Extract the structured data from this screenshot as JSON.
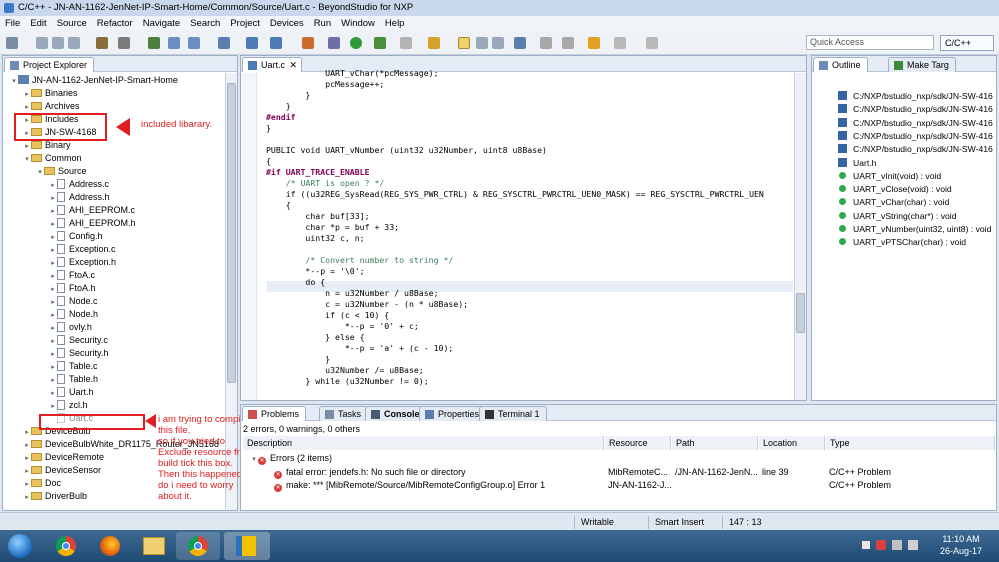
{
  "window": {
    "title": "C/C++ - JN-AN-1162-JenNet-IP-Smart-Home/Common/Source/Uart.c - BeyondStudio for NXP"
  },
  "menu": [
    "File",
    "Edit",
    "Source",
    "Refactor",
    "Navigate",
    "Search",
    "Project",
    "Devices",
    "Run",
    "Window",
    "Help"
  ],
  "toolbar": {
    "quick_access_placeholder": "Quick Access",
    "perspective": "C/C++"
  },
  "project_explorer": {
    "tab": "Project Explorer",
    "items": [
      {
        "label": "JN-AN-1162-JenNet-IP-Smart-Home",
        "kind": "project",
        "twisty": "▾"
      },
      {
        "label": "Binaries",
        "kind": "folder",
        "twisty": "▸"
      },
      {
        "label": "Archives",
        "kind": "folder",
        "twisty": "▸"
      },
      {
        "label": "Includes",
        "kind": "folder",
        "twisty": "▸"
      },
      {
        "label": "JN-SW-4168",
        "kind": "folder",
        "twisty": "▸"
      },
      {
        "label": "Binary",
        "kind": "folder",
        "twisty": "▸"
      },
      {
        "label": "Common",
        "kind": "folder",
        "twisty": "▾"
      },
      {
        "label": "Source",
        "kind": "folder",
        "twisty": "▾"
      },
      {
        "label": "Address.c",
        "kind": "c",
        "twisty": "▸"
      },
      {
        "label": "Address.h",
        "kind": "h",
        "twisty": "▸"
      },
      {
        "label": "AHI_EEPROM.c",
        "kind": "c",
        "twisty": "▸"
      },
      {
        "label": "AHI_EEPROM.h",
        "kind": "h",
        "twisty": "▸"
      },
      {
        "label": "Config.h",
        "kind": "h",
        "twisty": "▸"
      },
      {
        "label": "Exception.c",
        "kind": "c",
        "twisty": "▸"
      },
      {
        "label": "Exception.h",
        "kind": "h",
        "twisty": "▸"
      },
      {
        "label": "FtoA.c",
        "kind": "c",
        "twisty": "▸"
      },
      {
        "label": "FtoA.h",
        "kind": "h",
        "twisty": "▸"
      },
      {
        "label": "Node.c",
        "kind": "c",
        "twisty": "▸"
      },
      {
        "label": "Node.h",
        "kind": "h",
        "twisty": "▸"
      },
      {
        "label": "ovly.h",
        "kind": "h",
        "twisty": "▸"
      },
      {
        "label": "Security.c",
        "kind": "c",
        "twisty": "▸"
      },
      {
        "label": "Security.h",
        "kind": "h",
        "twisty": "▸"
      },
      {
        "label": "Table.c",
        "kind": "c",
        "twisty": "▸"
      },
      {
        "label": "Table.h",
        "kind": "h",
        "twisty": "▸"
      },
      {
        "label": "Uart.h",
        "kind": "h",
        "twisty": "▸"
      },
      {
        "label": "zcl.h",
        "kind": "h",
        "twisty": "▸"
      },
      {
        "label": "Uart.c",
        "kind": "c-excluded",
        "twisty": ""
      },
      {
        "label": "DeviceBulb",
        "kind": "folder",
        "twisty": "▸"
      },
      {
        "label": "DeviceBulbWhite_DR1175_Router_JN5168",
        "kind": "folder",
        "twisty": "▸"
      },
      {
        "label": "DeviceRemote",
        "kind": "folder",
        "twisty": "▸"
      },
      {
        "label": "DeviceSensor",
        "kind": "folder",
        "twisty": "▸"
      },
      {
        "label": "Doc",
        "kind": "folder",
        "twisty": "▸"
      },
      {
        "label": "DriverBulb",
        "kind": "folder",
        "twisty": "▸"
      }
    ]
  },
  "annotations": {
    "included_library": "included libarary.",
    "note_lines": [
      "i am trying to compile",
      "this file.",
      "so if you tried to",
      "Exclude resource from",
      "build tick this box.",
      "Then this happened.",
      "do i need to worry",
      "about it."
    ]
  },
  "editor": {
    "tab": "Uart.c",
    "lines": [
      "            UART_vChar(*pcMessage);",
      "            pcMessage++;",
      "        }",
      "    }",
      "#endif",
      "}",
      "",
      "PUBLIC void UART_vNumber (uint32 u32Number, uint8 u8Base)",
      "{",
      "#if UART_TRACE_ENABLE",
      "    /* UART is open ? */",
      "    if ((u32REG_SysRead(REG_SYS_PWR_CTRL) & REG_SYSCTRL_PWRCTRL_UEN0_MASK) == REG_SYSCTRL_PWRCTRL_UEN",
      "    {",
      "        char buf[33];",
      "        char *p = buf + 33;",
      "        uint32 c, n;",
      "",
      "        /* Convert number to string */",
      "        *--p = '\\0';",
      "        do {",
      "            n = u32Number / u8Base;",
      "            c = u32Number - (n * u8Base);",
      "            if (c < 10) {",
      "                *--p = '0' + c;",
      "            } else {",
      "                *--p = 'a' + (c - 10);",
      "            }",
      "            u32Number /= u8Base;",
      "        } while (u32Number != 0);"
    ]
  },
  "outline": {
    "tabs": [
      "Outline",
      "Make Targ"
    ],
    "items": [
      {
        "label": "C:/NXP/bstudio_nxp/sdk/JN-SW-416",
        "kind": "include"
      },
      {
        "label": "C:/NXP/bstudio_nxp/sdk/JN-SW-416",
        "kind": "include"
      },
      {
        "label": "C:/NXP/bstudio_nxp/sdk/JN-SW-416",
        "kind": "include"
      },
      {
        "label": "C:/NXP/bstudio_nxp/sdk/JN-SW-416",
        "kind": "include"
      },
      {
        "label": "C:/NXP/bstudio_nxp/sdk/JN-SW-416",
        "kind": "include"
      },
      {
        "label": "Uart.h",
        "kind": "include"
      },
      {
        "label": "UART_vInit(void) : void",
        "kind": "function"
      },
      {
        "label": "UART_vClose(void) : void",
        "kind": "function"
      },
      {
        "label": "UART_vChar(char) : void",
        "kind": "function"
      },
      {
        "label": "UART_vString(char*) : void",
        "kind": "function"
      },
      {
        "label": "UART_vNumber(uint32, uint8) : void",
        "kind": "function"
      },
      {
        "label": "UART_vPTSChar(char) : void",
        "kind": "function"
      }
    ]
  },
  "bottom_panel": {
    "tabs": [
      "Problems",
      "Tasks",
      "Console",
      "Properties",
      "Terminal 1"
    ],
    "summary": "2 errors, 0 warnings, 0 others",
    "columns": [
      "Description",
      "Resource",
      "Path",
      "Location",
      "Type"
    ],
    "group": "Errors (2 items)",
    "rows": [
      {
        "description": "fatal error: jendefs.h: No such file or directory",
        "resource": "MibRemoteC...",
        "path": "/JN-AN-1162-JenN...",
        "location": "line 39",
        "type": "C/C++ Problem"
      },
      {
        "description": "make: *** [MibRemote/Source/MibRemoteConfigGroup.o] Error 1",
        "resource": "JN-AN-1162-J...",
        "path": "",
        "location": "",
        "type": "C/C++ Problem"
      }
    ]
  },
  "status": {
    "writable": "Writable",
    "insert_mode": "Smart Insert",
    "position": "147 : 13"
  },
  "taskbar": {
    "time": "11:10 AM",
    "date": "26-Aug-17"
  }
}
